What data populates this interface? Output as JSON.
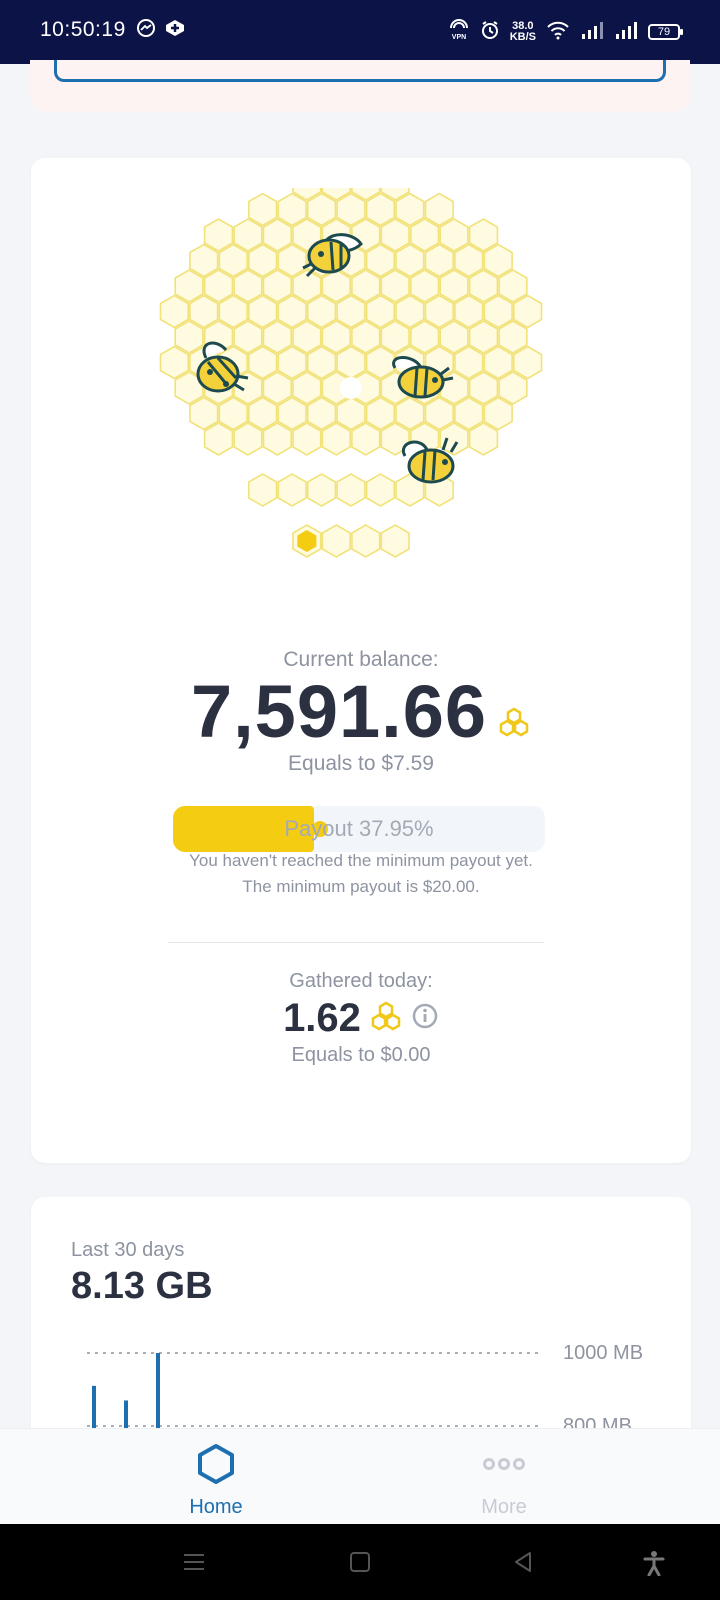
{
  "status_bar": {
    "time": "10:50:19",
    "speed_value": "38.0",
    "speed_unit": "KB/S",
    "battery": "79",
    "vpn_label": "VPN",
    "icons": [
      "messenger-icon",
      "app-icon",
      "vpn-icon",
      "alarm-icon",
      "wifi-icon",
      "signal-icon",
      "signal-icon-2",
      "battery-icon"
    ]
  },
  "balance": {
    "label": "Current balance:",
    "value": "7,591.66",
    "equals": "Equals to $7.59"
  },
  "payout": {
    "label": "Payout 37.95%",
    "progress": 0.3795,
    "note_line1": "You haven't reached the minimum payout yet.",
    "note_line2": "The minimum payout is $20.00."
  },
  "today": {
    "label": "Gathered today:",
    "value": "1.62",
    "equals": "Equals to $0.00"
  },
  "stats": {
    "period": "Last 30 days",
    "total": "8.13 GB"
  },
  "chart_data": {
    "type": "bar",
    "xlabel": "",
    "ylabel": "",
    "y_ticks": [
      "1000 MB",
      "800 MB"
    ],
    "values": [
      910,
      870,
      1000
    ],
    "grid": true
  },
  "bottom_nav": {
    "items": [
      {
        "label": "Home",
        "icon": "hexagon-icon",
        "active": true
      },
      {
        "label": "More",
        "icon": "more-dots-icon",
        "active": false
      }
    ]
  },
  "colors": {
    "accent": "#1e6fb0",
    "honey": "#f4cc12",
    "status_bar": "#0b1347"
  }
}
